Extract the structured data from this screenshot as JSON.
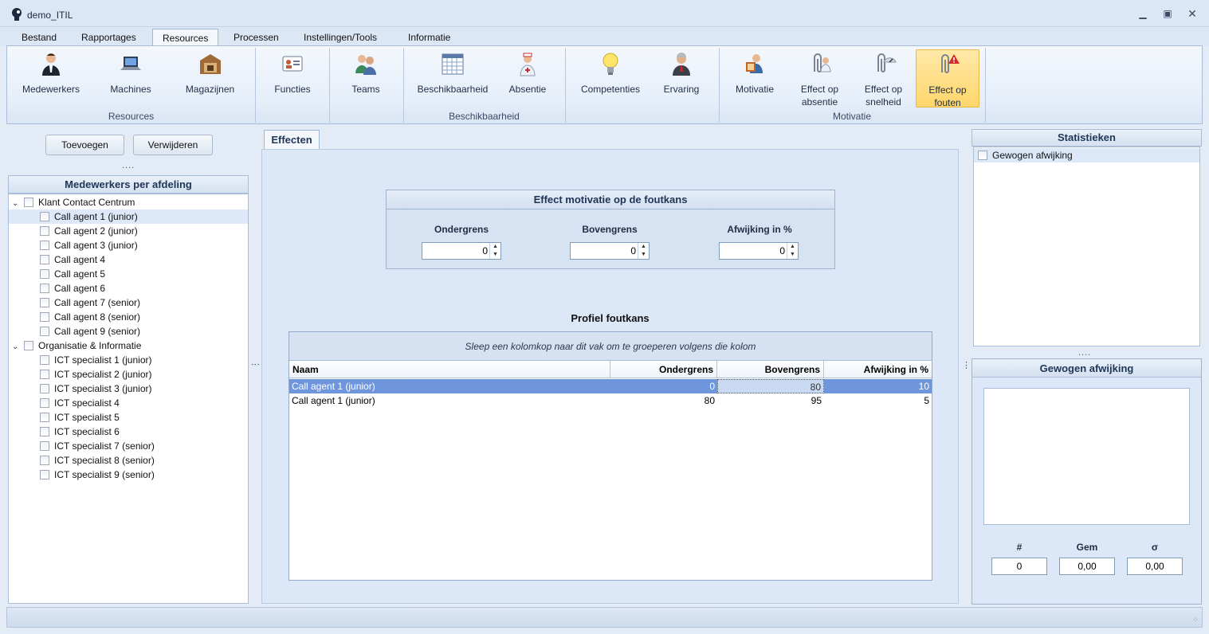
{
  "window": {
    "title": "demo_ITIL"
  },
  "menu": {
    "tabs": [
      "Bestand",
      "Rapportages",
      "Resources",
      "Processen",
      "Instellingen/Tools",
      "Informatie"
    ],
    "active": "Resources"
  },
  "ribbon": {
    "groups": {
      "resources": "Resources",
      "beschikbaarheid": "Beschikbaarheid",
      "motivatie": "Motivatie"
    },
    "buttons": {
      "medewerkers": "Medewerkers",
      "machines": "Machines",
      "magazijnen": "Magazijnen",
      "functies": "Functies",
      "teams": "Teams",
      "beschikbaarheid": "Beschikbaarheid",
      "absentie": "Absentie",
      "competenties": "Competenties",
      "ervaring": "Ervaring",
      "motivatie": "Motivatie",
      "effect_absentie_1": "Effect op",
      "effect_absentie_2": "absentie",
      "effect_snelheid_1": "Effect op",
      "effect_snelheid_2": "snelheid",
      "effect_fouten_1": "Effect op",
      "effect_fouten_2": "fouten"
    }
  },
  "left": {
    "add_label": "Toevoegen",
    "remove_label": "Verwijderen",
    "splitter": "....",
    "header": "Medewerkers per afdeling",
    "departments": [
      {
        "name": "Klant Contact Centrum",
        "items": [
          "Call agent 1 (junior)",
          "Call agent 2 (junior)",
          "Call agent 3 (junior)",
          "Call agent 4",
          "Call agent 5",
          "Call agent 6",
          "Call agent 7 (senior)",
          "Call agent 8 (senior)",
          "Call agent 9 (senior)"
        ]
      },
      {
        "name": "Organisatie & Informatie",
        "items": [
          "ICT specialist 1 (junior)",
          "ICT specialist 2 (junior)",
          "ICT specialist 3 (junior)",
          "ICT specialist 4",
          "ICT specialist 5",
          "ICT specialist 6",
          "ICT specialist 7 (senior)",
          "ICT specialist 8 (senior)",
          "ICT specialist 9 (senior)"
        ]
      }
    ]
  },
  "center": {
    "tab": "Effecten",
    "effect_box": {
      "title": "Effect motivatie op de foutkans",
      "ondergrens_label": "Ondergrens",
      "bovengrens_label": "Bovengrens",
      "afwijking_label": "Afwijking in %",
      "ondergrens": "0",
      "bovengrens": "0",
      "afwijking": "0"
    },
    "profile_title": "Profiel foutkans",
    "grid": {
      "group_hint": "Sleep een kolomkop naar dit vak om te groeperen volgens die kolom",
      "columns": [
        "Naam",
        "Ondergrens",
        "Bovengrens",
        "Afwijking in %"
      ],
      "rows": [
        [
          "Call agent 1 (junior)",
          "0",
          "80",
          "10"
        ],
        [
          "Call agent 1 (junior)",
          "80",
          "95",
          "5"
        ]
      ]
    }
  },
  "right": {
    "stats_header": "Statistieken",
    "stats_item": "Gewogen afwijking",
    "splitter": "....",
    "weighted_header": "Gewogen afwijking",
    "count_label": "#",
    "mean_label": "Gem",
    "sigma_label": "σ",
    "count": "0",
    "mean": "0,00",
    "sigma": "0,00"
  },
  "colors": {
    "accent": "#6a8fd0",
    "selected_row": "#6f96dc",
    "ribbon_selected": "#ffd66b"
  }
}
